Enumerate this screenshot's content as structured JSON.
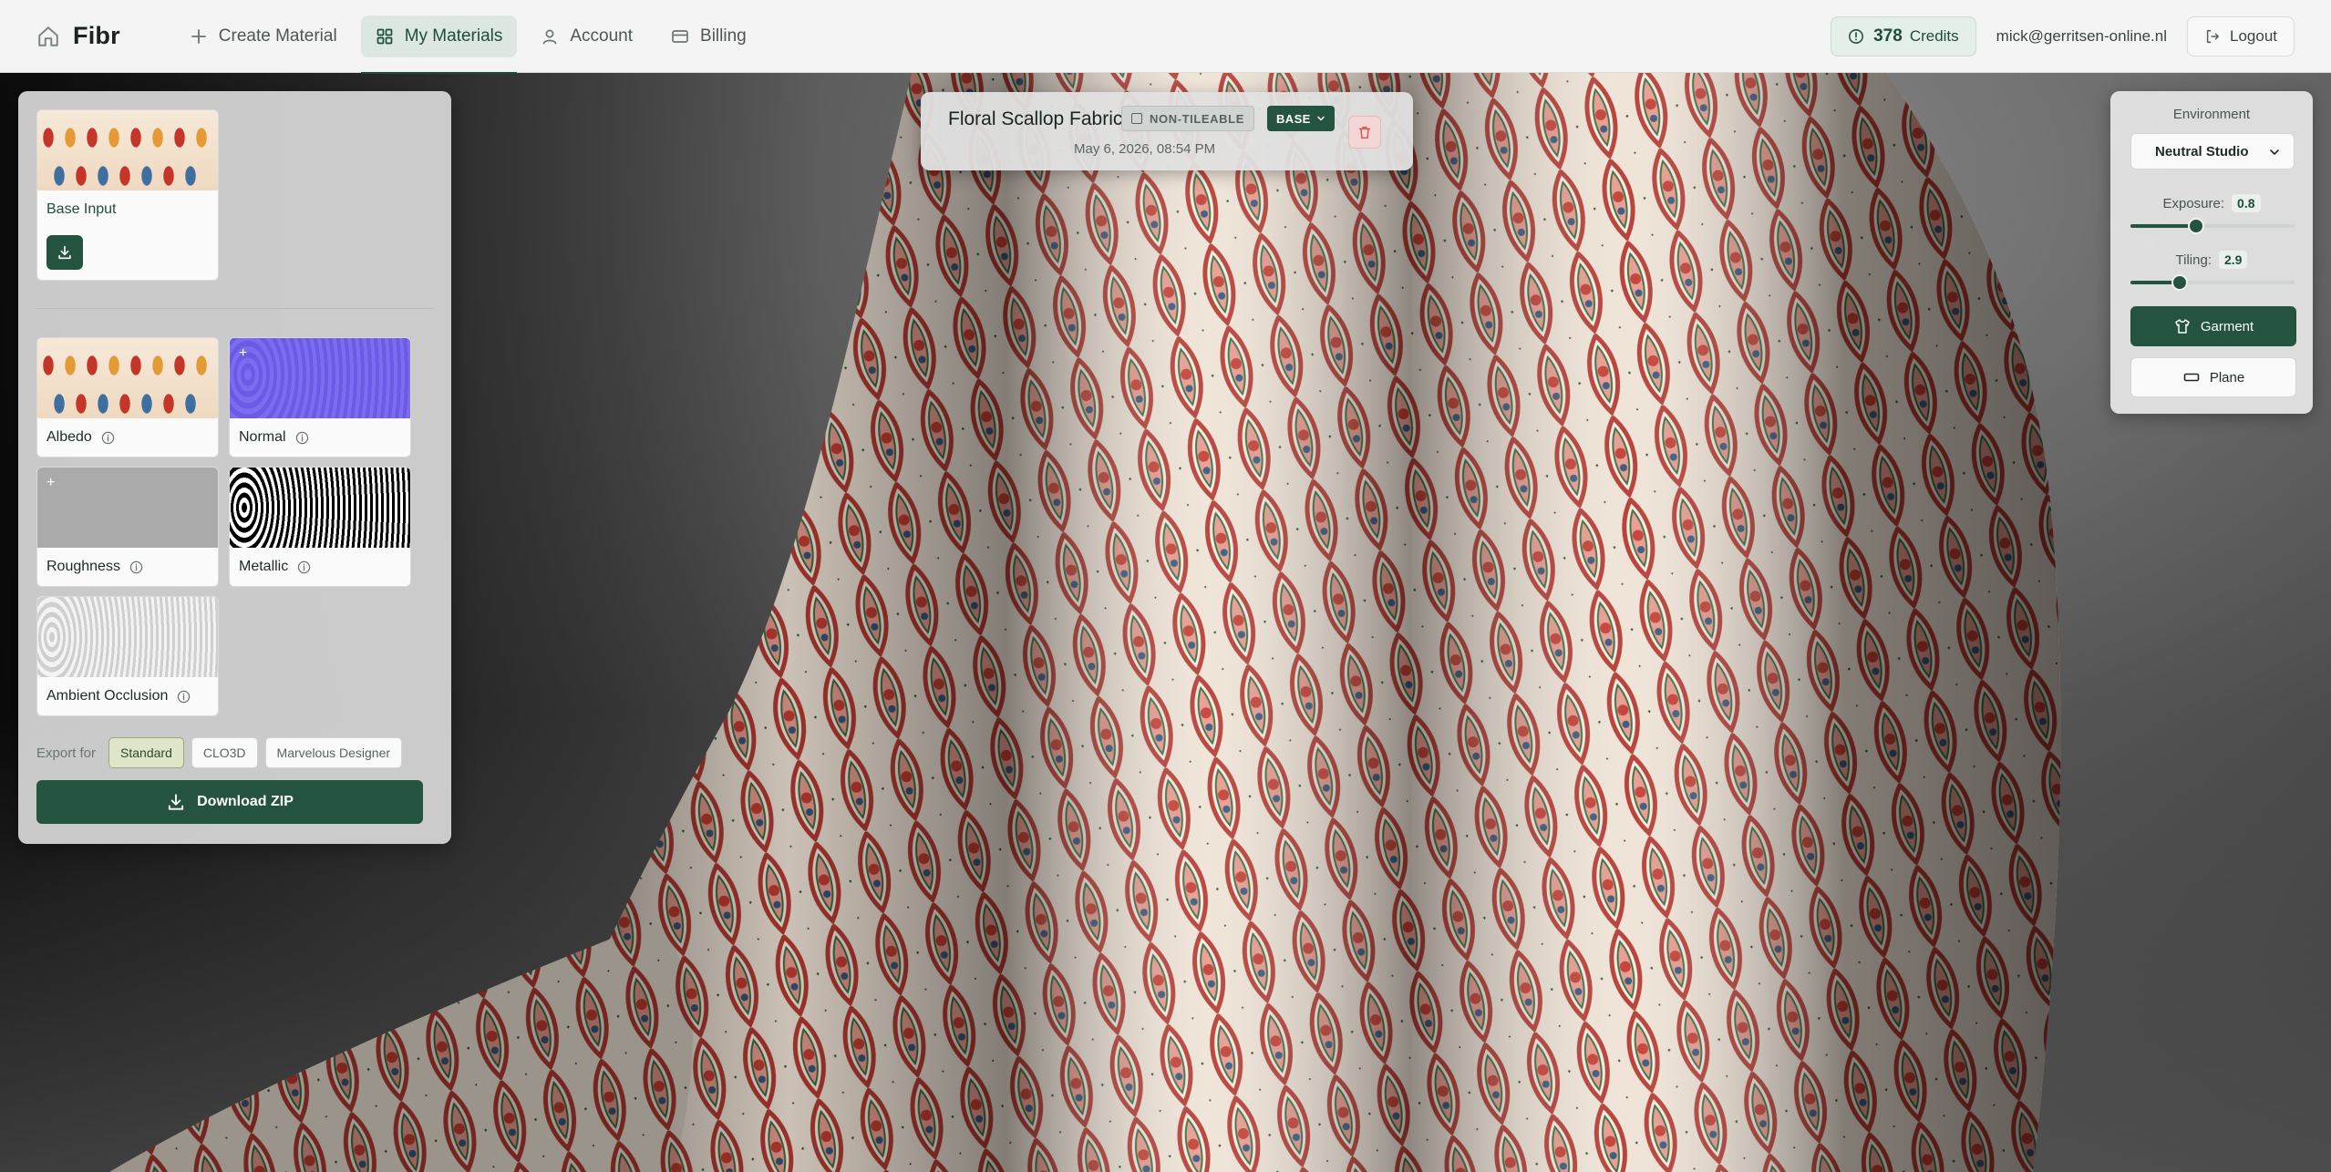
{
  "app": {
    "brand": "Fibr"
  },
  "nav": {
    "items": [
      {
        "label": "Create Material",
        "icon": "plus-icon"
      },
      {
        "label": "My Materials",
        "icon": "grid-icon",
        "active": true
      },
      {
        "label": "Account",
        "icon": "user-icon"
      },
      {
        "label": "Billing",
        "icon": "credit-card-icon"
      }
    ]
  },
  "account": {
    "credits_value": "378",
    "credits_label": "Credits",
    "email": "mick@gerritsen-online.nl",
    "logout_label": "Logout"
  },
  "material": {
    "name": "Floral Scallop Fabric",
    "tileable_badge": "NON-TILEABLE",
    "base_badge": "BASE",
    "date": "May 6, 2026, 08:54 PM"
  },
  "maps": {
    "base_input": "Base Input",
    "albedo": "Albedo",
    "normal": "Normal",
    "roughness": "Roughness",
    "metallic": "Metallic",
    "ambient_occlusion": "Ambient Occlusion"
  },
  "export": {
    "label": "Export for",
    "options": [
      "Standard",
      "CLO3D",
      "Marvelous Designer"
    ],
    "selected": "Standard",
    "download_label": "Download ZIP"
  },
  "environment": {
    "title": "Environment",
    "selected": "Neutral Studio",
    "exposure_label": "Exposure:",
    "exposure_value": "0.8",
    "exposure_fraction": 0.4,
    "tiling_label": "Tiling:",
    "tiling_value": "2.9",
    "tiling_fraction": 0.3,
    "garment_label": "Garment",
    "plane_label": "Plane"
  },
  "colors": {
    "accent": "#24543f",
    "accent_light": "#dce7e2",
    "danger_bg": "#f3d6d6"
  }
}
